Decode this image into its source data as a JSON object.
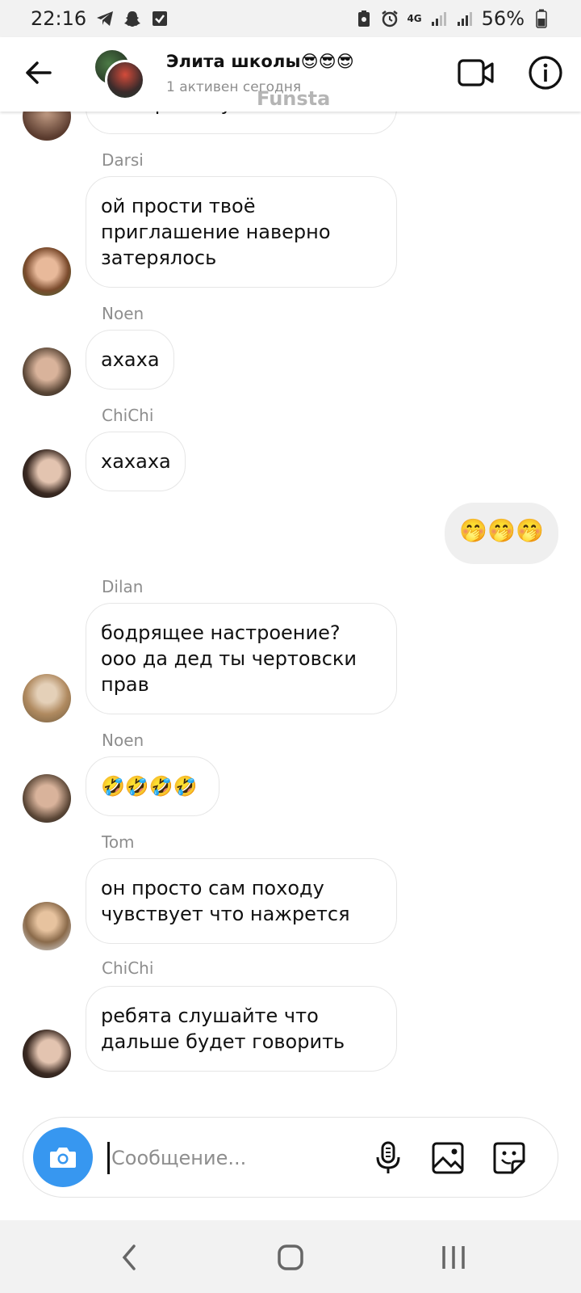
{
  "status_bar": {
    "time": "22:16",
    "battery": "56%",
    "network": "4G"
  },
  "header": {
    "title": "Элита школы😎😎😎",
    "subtitle": "1 активен сегодня",
    "watermark": "Funsta"
  },
  "messages": [
    {
      "sender": "",
      "text": "шикарная тусовка"
    },
    {
      "sender": "Darsi",
      "text": "ой прости твоё\nприглашение наверно\nзатерялось"
    },
    {
      "sender": "Noen",
      "text": "ахаха"
    },
    {
      "sender": "ChiChi",
      "text": "хахаха"
    },
    {
      "sender": "",
      "text": "🤭🤭🤭",
      "own": true
    },
    {
      "sender": "Dilan",
      "text": "бодрящее настроение?\nооо да дед ты чертовски\nправ"
    },
    {
      "sender": "Noen",
      "text": "🤣🤣🤣🤣"
    },
    {
      "sender": "Tom",
      "text": "он просто сам походу\nчувствует что нажрется"
    },
    {
      "sender": "ChiChi",
      "text": "ребята слушайте что\nдальше будет говорить"
    }
  ],
  "composer": {
    "placeholder": "Сообщение..."
  },
  "colors": {
    "accent": "#3797f0",
    "own_bubble": "#efefef",
    "secondary_text": "#8e8e8e"
  },
  "icons": [
    "back-arrow-icon",
    "video-call-icon",
    "info-icon",
    "camera-icon",
    "microphone-icon",
    "gallery-icon",
    "sticker-icon"
  ]
}
